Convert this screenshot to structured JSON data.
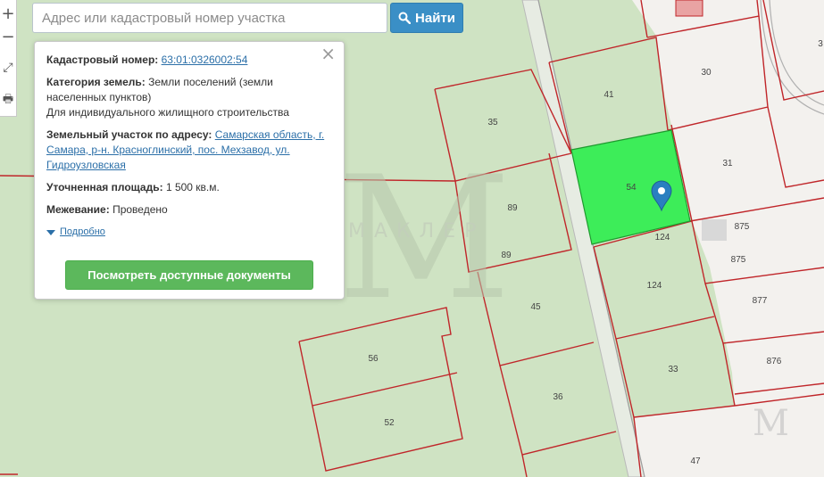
{
  "search": {
    "placeholder": "Адрес или кадастровый номер участка",
    "button_label": "Найти",
    "button_icon": "search-icon"
  },
  "tools": [
    {
      "name": "zoom-in-button",
      "glyph": "+"
    },
    {
      "name": "zoom-out-button",
      "glyph": "−"
    },
    {
      "name": "fullscreen-button",
      "glyph": "⤢"
    },
    {
      "name": "print-button",
      "glyph": "🖶"
    }
  ],
  "popup": {
    "close_glyph": "×",
    "cadastral_label": "Кадастровый номер:",
    "cadastral_value": "63:01:0326002:54",
    "category_label": "Категория земель:",
    "category_value": "Земли поселений (земли населенных пунктов)",
    "use_value": "Для индивидуального жилищного строительства",
    "address_label": "Земельный участок по адресу:",
    "address_value": "Самарская область, г. Самара, р-н. Красноглинский, пос. Мехзавод, ул. Гидроузловская",
    "area_label": "Уточненная площадь:",
    "area_value": "1 500 кв.м.",
    "survey_label": "Межевание:",
    "survey_value": "Проведено",
    "more_label": "Подробно",
    "docs_button": "Посмотреть доступные документы"
  },
  "map": {
    "colors": {
      "background": "#cfe3c3",
      "developed": "#f3f1ee",
      "boundary": "#c0262a",
      "selected_fill": "#3ded59",
      "selected_stroke": "#1f9a2f",
      "marker": "#2a7fc0",
      "watermark": "#b7c7ad"
    },
    "watermark_text": "МАКЛЕР",
    "watermark_logo": "M",
    "parcels": [
      "30",
      "41",
      "35",
      "54",
      "31",
      "89",
      "89",
      "875",
      "124",
      "875",
      "124",
      "45",
      "877",
      "56",
      "33",
      "876",
      "36",
      "52",
      "47",
      "3"
    ]
  }
}
